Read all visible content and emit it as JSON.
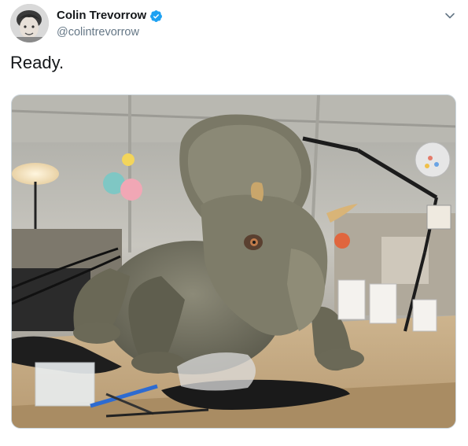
{
  "tweet": {
    "author": {
      "display_name": "Colin Trevorrow",
      "handle": "@colintrevorrow",
      "verified": true,
      "avatar_icon": "avatar-photo-icon"
    },
    "text": "Ready.",
    "menu_icon": "chevron-down-icon",
    "media": {
      "type": "photo",
      "icon": "photo-triceratops-animatronic"
    }
  },
  "colors": {
    "verified_badge": "#1da1f2",
    "handle_gray": "#657786",
    "caret_gray": "#657786",
    "text": "#14171a"
  }
}
